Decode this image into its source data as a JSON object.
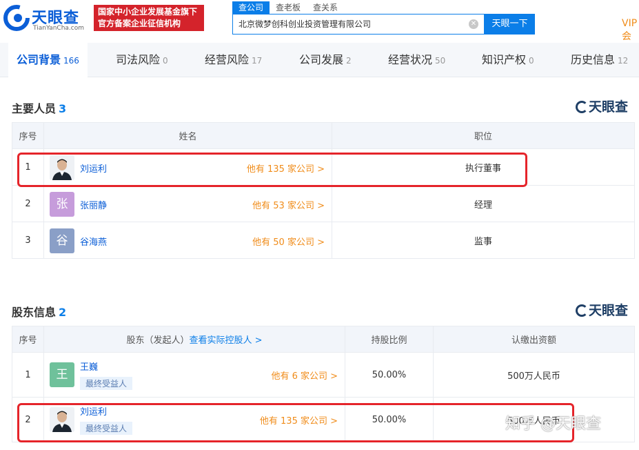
{
  "header": {
    "logo_text": "天眼查",
    "logo_sub": "TianYanCha.com",
    "badge_line1": "国家中小企业发展基金旗下",
    "badge_line2": "官方备案企业征信机构",
    "search_tabs": [
      "查公司",
      "查老板",
      "查关系"
    ],
    "search_value": "北京微梦创科创业投资管理有限公司",
    "search_button": "天眼一下",
    "vip": "VIP会"
  },
  "nav": {
    "tabs": [
      {
        "label": "公司背景",
        "count": "166"
      },
      {
        "label": "司法风险",
        "count": "0"
      },
      {
        "label": "经营风险",
        "count": "17"
      },
      {
        "label": "公司发展",
        "count": "2"
      },
      {
        "label": "经营状况",
        "count": "50"
      },
      {
        "label": "知识产权",
        "count": "0"
      },
      {
        "label": "历史信息",
        "count": "12"
      }
    ]
  },
  "watermark": "天眼查",
  "personnel": {
    "title": "主要人员",
    "count": "3",
    "headers": [
      "序号",
      "姓名",
      "职位"
    ],
    "rows": [
      {
        "no": "1",
        "avatar": "",
        "name": "刘运利",
        "more": "他有 135 家公司 >",
        "position": "执行董事"
      },
      {
        "no": "2",
        "avatar": "张",
        "name": "张丽静",
        "more": "他有 53 家公司 >",
        "position": "经理"
      },
      {
        "no": "3",
        "avatar": "谷",
        "name": "谷海燕",
        "more": "他有 50 家公司 >",
        "position": "监事"
      }
    ]
  },
  "shareholders": {
    "title": "股东信息",
    "count": "2",
    "headers": [
      "序号",
      "股东（发起人）",
      "查看实际控股人 >",
      "持股比例",
      "认缴出资额"
    ],
    "rows": [
      {
        "no": "1",
        "avatar": "王",
        "name": "王巍",
        "tag": "最终受益人",
        "more": "他有 6 家公司 >",
        "ratio": "50.00%",
        "amount": "500万人民币"
      },
      {
        "no": "2",
        "avatar": "",
        "name": "刘运利",
        "tag": "最终受益人",
        "more": "他有 135 家公司 >",
        "ratio": "50.00%",
        "amount": "500万人民币"
      }
    ]
  },
  "zhihu_watermark": "知乎 @天眼查",
  "colors": {
    "brand": "#0b7ee8",
    "accent": "#f08c1a",
    "badge": "#d4232b",
    "highlight": "#e5242a"
  }
}
